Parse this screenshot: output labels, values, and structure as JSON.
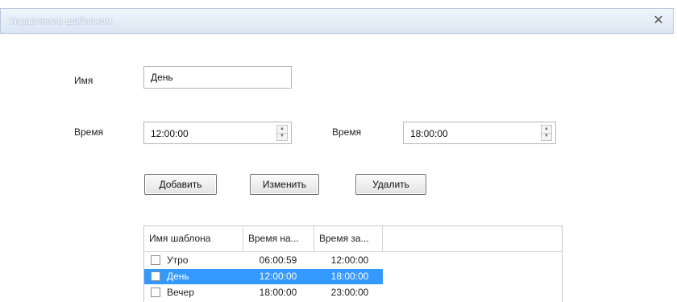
{
  "window": {
    "title": "Управление шаблоном",
    "close_glyph": "✕"
  },
  "form": {
    "name_label": "Имя",
    "name_value": "День",
    "time1_label": "Время",
    "time1_value": "12:00:00",
    "time2_label": "Время",
    "time2_value": "18:00:00"
  },
  "buttons": {
    "add": "Добавить",
    "edit": "Изменить",
    "delete": "Удалить"
  },
  "table": {
    "columns": [
      "Имя шаблона",
      "Время на...",
      "Время за..."
    ],
    "rows": [
      {
        "name": "Утро",
        "start": "06:00:59",
        "end": "12:00:00",
        "selected": false
      },
      {
        "name": "День",
        "start": "12:00:00",
        "end": "18:00:00",
        "selected": true
      },
      {
        "name": "Вечер",
        "start": "18:00:00",
        "end": "23:00:00",
        "selected": false
      }
    ]
  },
  "colors": {
    "selection": "#3399ff",
    "titlebar": "#dbe6f3"
  }
}
